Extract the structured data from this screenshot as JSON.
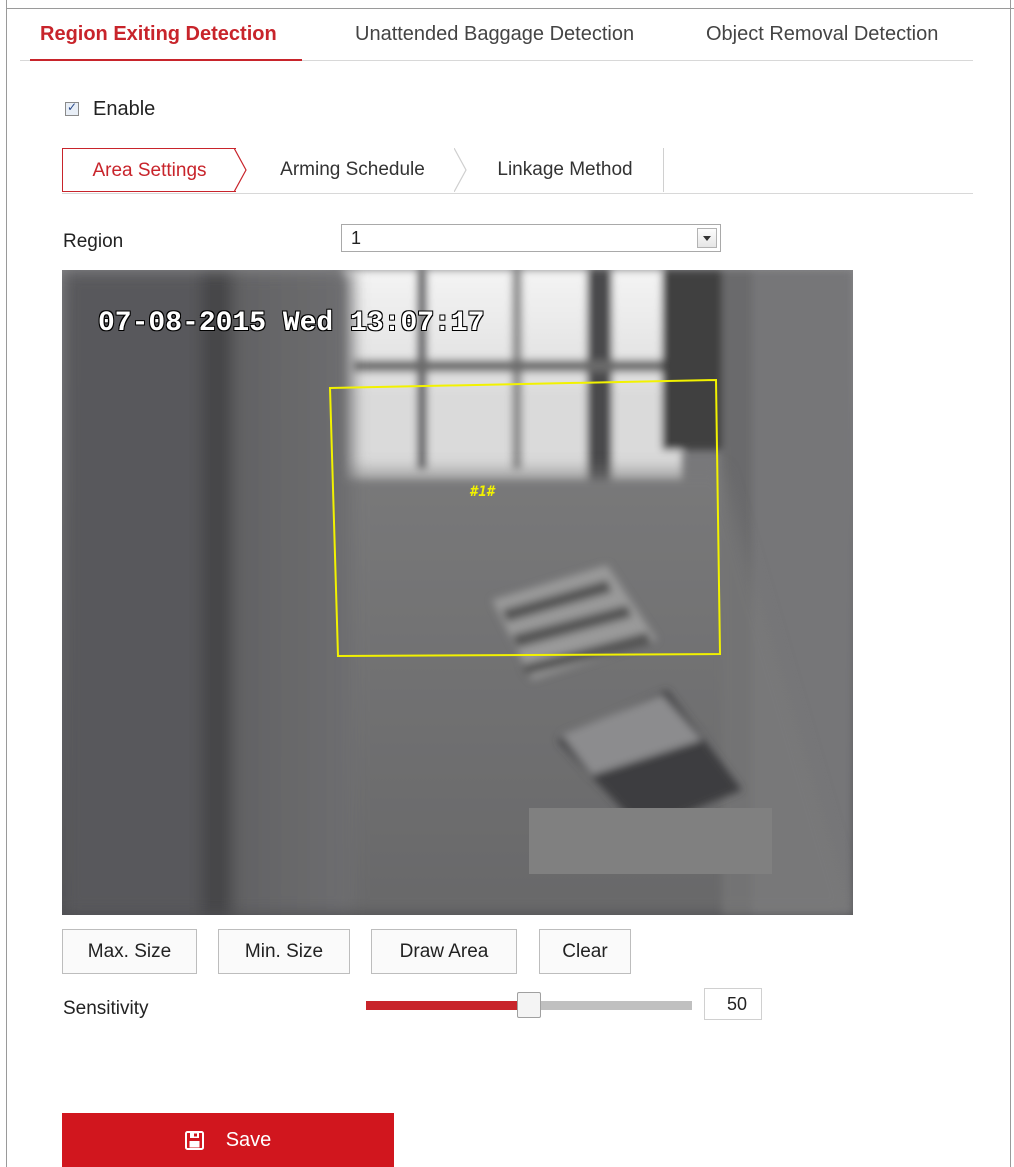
{
  "tabs": {
    "items": [
      {
        "label": "Region Exiting Detection",
        "active": true
      },
      {
        "label": "Unattended Baggage Detection",
        "active": false
      },
      {
        "label": "Object Removal Detection",
        "active": false
      }
    ]
  },
  "enable": {
    "label": "Enable",
    "checked": true
  },
  "subtabs": {
    "items": [
      {
        "label": "Area Settings",
        "active": true
      },
      {
        "label": "Arming Schedule",
        "active": false
      },
      {
        "label": "Linkage Method",
        "active": false
      }
    ]
  },
  "region": {
    "label": "Region",
    "value": "1"
  },
  "video": {
    "osd_time": "07-08-2015 Wed 13:07:17",
    "region_tag": "#1#"
  },
  "buttons": {
    "max_size": "Max. Size",
    "min_size": "Min. Size",
    "draw_area": "Draw Area",
    "clear": "Clear"
  },
  "sensitivity": {
    "label": "Sensitivity",
    "value": "50",
    "level_percent": 50
  },
  "save": {
    "label": "Save",
    "icon": "save-icon"
  },
  "colors": {
    "accent": "#c8242b",
    "save_button": "#d1161e",
    "region_outline": "#f2f200"
  }
}
